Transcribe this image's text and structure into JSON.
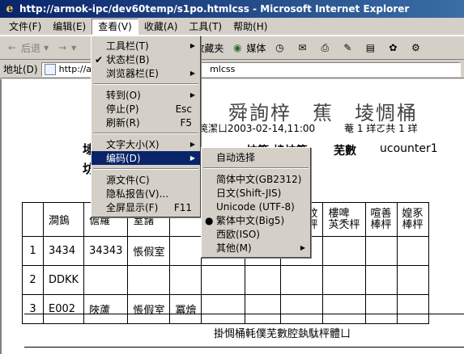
{
  "window": {
    "title": "http://armok-ipc/dev60temp/s1po.htmlcss - Microsoft Internet Explorer"
  },
  "menubar": [
    {
      "label": "文件(F)"
    },
    {
      "label": "编辑(E)"
    },
    {
      "label": "查看(V)"
    },
    {
      "label": "收藏(A)"
    },
    {
      "label": "工具(T)"
    },
    {
      "label": "帮助(H)"
    }
  ],
  "toolbar": {
    "back_label": "后退",
    "favorites_label": "收藏夹",
    "media_label": "媒体"
  },
  "address": {
    "label": "地址(D)",
    "url_left": "http://a",
    "url_right": "mlcss"
  },
  "view_menu": {
    "items": [
      {
        "label": "工具栏(T)",
        "arrow": true
      },
      {
        "label": "状态栏(B)",
        "checked": true
      },
      {
        "label": "浏览器栏(E)",
        "arrow": true
      },
      {
        "label": "转到(O)",
        "arrow": true
      },
      {
        "label": "停止(P)",
        "shortcut": "Esc"
      },
      {
        "label": "刷新(R)",
        "shortcut": "F5"
      },
      {
        "label": "文字大小(X)",
        "arrow": true
      },
      {
        "label": "编码(D)",
        "arrow": true,
        "highlighted": true
      },
      {
        "label": "源文件(C)"
      },
      {
        "label": "隐私报告(V)..."
      },
      {
        "label": "全屏显示(F)",
        "shortcut": "F11"
      }
    ]
  },
  "encoding_menu": {
    "items": [
      {
        "label": "自动选择"
      },
      {
        "label": "简体中文(GB2312)"
      },
      {
        "label": "日文(Shift-JIS)"
      },
      {
        "label": "Unicode (UTF-8)"
      },
      {
        "label": "繁体中文(Big5)",
        "selected": true
      },
      {
        "label": "西欧(ISO)"
      },
      {
        "label": "其他(M)",
        "arrow": true
      }
    ]
  },
  "report": {
    "title": "舜詢梓　蕉　堎惆桶",
    "subtitle_prefix": "笢潔ㄩ",
    "date": "2003-02-14,11:00",
    "subtitle_right": "菴 1 珜ㄛ共 1 珜",
    "label_a": "埭",
    "label_b": "坊",
    "label_mid": "坊篚:埭坊篚",
    "label_count": "芜數",
    "counter": "ucounter1",
    "table": {
      "header": [
        "澗鎢",
        "儋蘿",
        "窒藷",
        "",
        "",
        "",
        "頗嗟妏\n蹈蛻枰",
        "樓啤\n芵秂枰",
        "喧善\n棒枰",
        "媓豖\n棒枰"
      ],
      "rows": [
        {
          "num": "1",
          "cells": [
            "3434",
            "34343",
            "悵假室"
          ]
        },
        {
          "num": "2",
          "cells": [
            "DDKK",
            "",
            ""
          ]
        },
        {
          "num": "3",
          "cells": [
            "E002",
            "陜蘆",
            "悵假室",
            "冪燴"
          ]
        }
      ]
    },
    "footer": "掛惆桶軞僕芜數腔埶駄枰體ㄩ"
  }
}
